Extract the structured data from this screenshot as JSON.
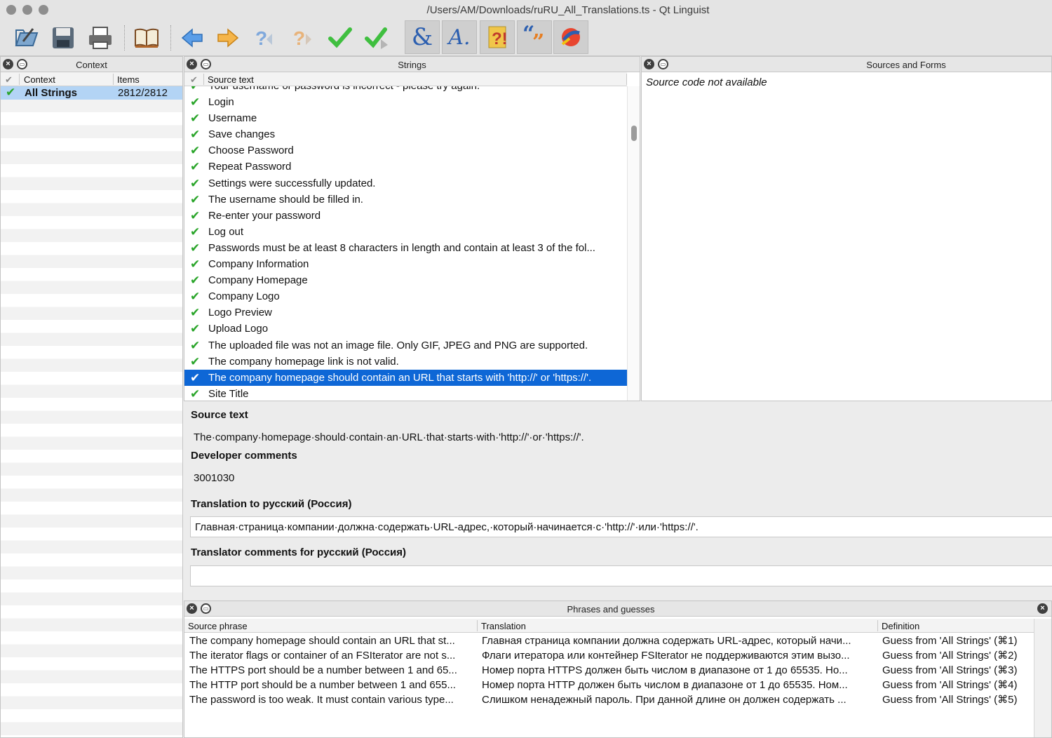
{
  "window": {
    "title": "/Users/AM/Downloads/ruRU_All_Translations.ts - Qt Linguist"
  },
  "toolbar": {
    "icons": [
      "open-icon",
      "save-icon",
      "print-icon",
      "phrasebook-icon",
      "prev-icon",
      "next-icon",
      "prev-unfinished-icon",
      "next-unfinished-icon",
      "done-icon",
      "done-next-icon",
      "accelerators-icon",
      "ending-punctuation-icon",
      "phrase-matches-icon",
      "place-markers-icon",
      "surrounding-whitespace-icon"
    ]
  },
  "context_panel": {
    "title": "Context",
    "columns": {
      "context": "Context",
      "items": "Items"
    },
    "rows": [
      {
        "name": "All Strings",
        "items": "2812/2812"
      }
    ]
  },
  "strings_panel": {
    "title": "Strings",
    "column": "Source text",
    "partial_top": "Your username or password is incorrect - please try again.",
    "rows": [
      "Login",
      "Username",
      "Save changes",
      "Choose Password",
      "Repeat Password",
      "Settings were successfully updated.",
      "The username should be filled in.",
      "Re-enter your password",
      "Log out",
      "Passwords must be at least 8 characters in length and contain at least 3 of the fol...",
      "Company Information",
      "Company Homepage",
      "Company Logo",
      "Logo Preview",
      "Upload Logo",
      "The uploaded file was not an image file. Only GIF, JPEG and PNG are supported.",
      "The company homepage link is not valid.",
      "The company homepage should contain an URL that starts with 'http://' or 'https://'.",
      "Site Title"
    ],
    "selected_index": 17
  },
  "sources_panel": {
    "title": "Sources and Forms",
    "message": "Source code not available"
  },
  "editor": {
    "source_label": "Source text",
    "source_value": "The·company·homepage·should·contain·an·URL·that·starts·with·'http://'·or·'https://'.",
    "dev_label": "Developer comments",
    "dev_value": "3001030",
    "translation_label": "Translation to русский (Россия)",
    "translation_value": "Главная·страница·компании·должна·содержать·URL-адрес,·который·начинается·с·'http://'·или·'https://'.",
    "comments_label": "Translator comments for русский (Россия)",
    "comments_value": ""
  },
  "phrases_panel": {
    "title": "Phrases and guesses",
    "columns": {
      "source": "Source phrase",
      "translation": "Translation",
      "definition": "Definition"
    },
    "rows": [
      {
        "source": "The company homepage should contain an URL that st...",
        "translation": "Главная страница компании должна содержать URL-адрес, который начи...",
        "definition": "Guess from 'All Strings' (⌘1)"
      },
      {
        "source": "The iterator flags or container of an FSIterator are not s...",
        "translation": "Флаги итератора или контейнер FSIterator не поддерживаются этим вызо...",
        "definition": "Guess from 'All Strings' (⌘2)"
      },
      {
        "source": "The HTTPS port should be a number between 1 and 65...",
        "translation": "Номер порта HTTPS должен быть числом в диапазоне от 1 до 65535. Но...",
        "definition": "Guess from 'All Strings' (⌘3)"
      },
      {
        "source": "The HTTP port should be a number between 1 and 655...",
        "translation": "Номер порта HTTP должен быть числом в диапазоне от 1 до 65535. Ном...",
        "definition": "Guess from 'All Strings' (⌘4)"
      },
      {
        "source": "The password is too weak. It must contain various type...",
        "translation": "Слишком ненадежный пароль. При данной длине он должен содержать ...",
        "definition": "Guess from 'All Strings' (⌘5)"
      }
    ]
  }
}
